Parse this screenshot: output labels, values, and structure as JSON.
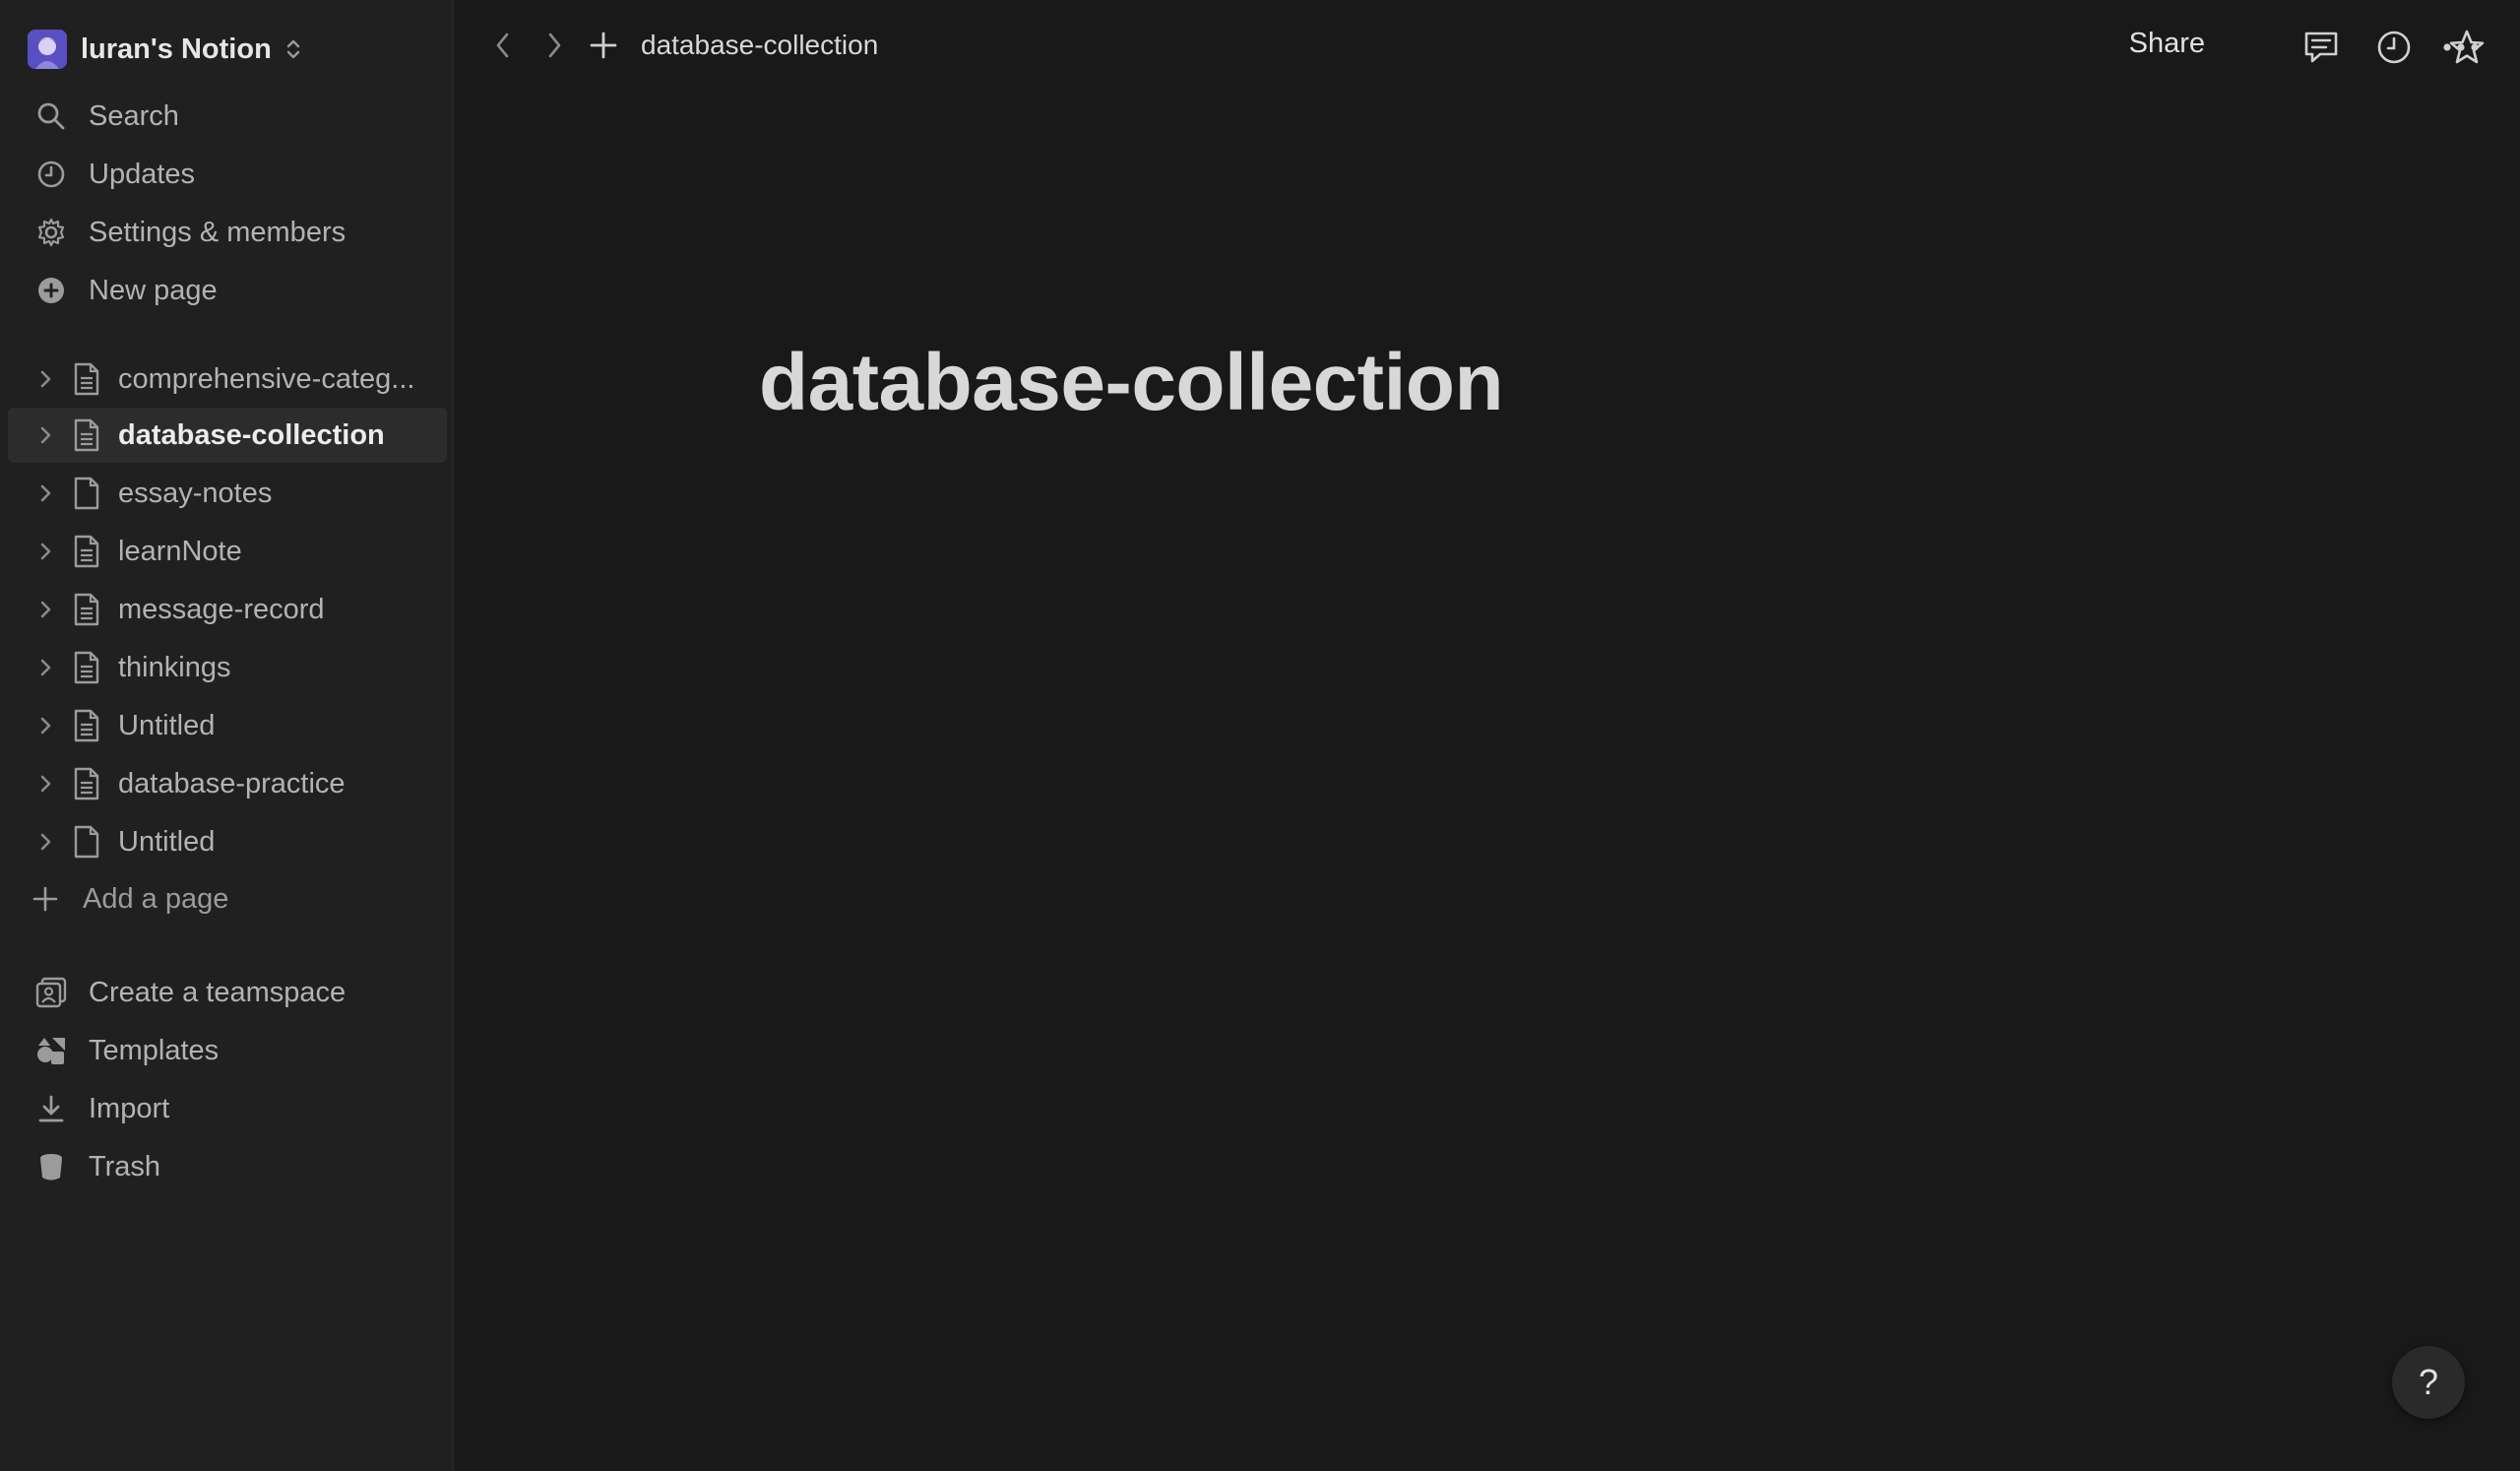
{
  "workspace": {
    "name": "luran's Notion"
  },
  "nav": {
    "search": "Search",
    "updates": "Updates",
    "settings": "Settings & members",
    "new_page": "New page"
  },
  "pages": [
    {
      "label": "comprehensive-categ...",
      "active": false
    },
    {
      "label": "database-collection",
      "active": true
    },
    {
      "label": "essay-notes",
      "active": false
    },
    {
      "label": "learnNote",
      "active": false
    },
    {
      "label": "message-record",
      "active": false
    },
    {
      "label": "thinkings",
      "active": false
    },
    {
      "label": "Untitled",
      "active": false
    },
    {
      "label": "database-practice",
      "active": false
    },
    {
      "label": "Untitled",
      "active": false
    }
  ],
  "add_page": "Add a page",
  "bottom_nav": {
    "teamspace": "Create a teamspace",
    "templates": "Templates",
    "import": "Import",
    "trash": "Trash"
  },
  "topbar": {
    "breadcrumb": "database-collection",
    "share": "Share"
  },
  "main": {
    "title": "database-collection"
  },
  "help": {
    "label": "?"
  },
  "colors": {
    "background": "#191919",
    "sidebar": "#202020",
    "active_item": "#2c2c2c"
  }
}
